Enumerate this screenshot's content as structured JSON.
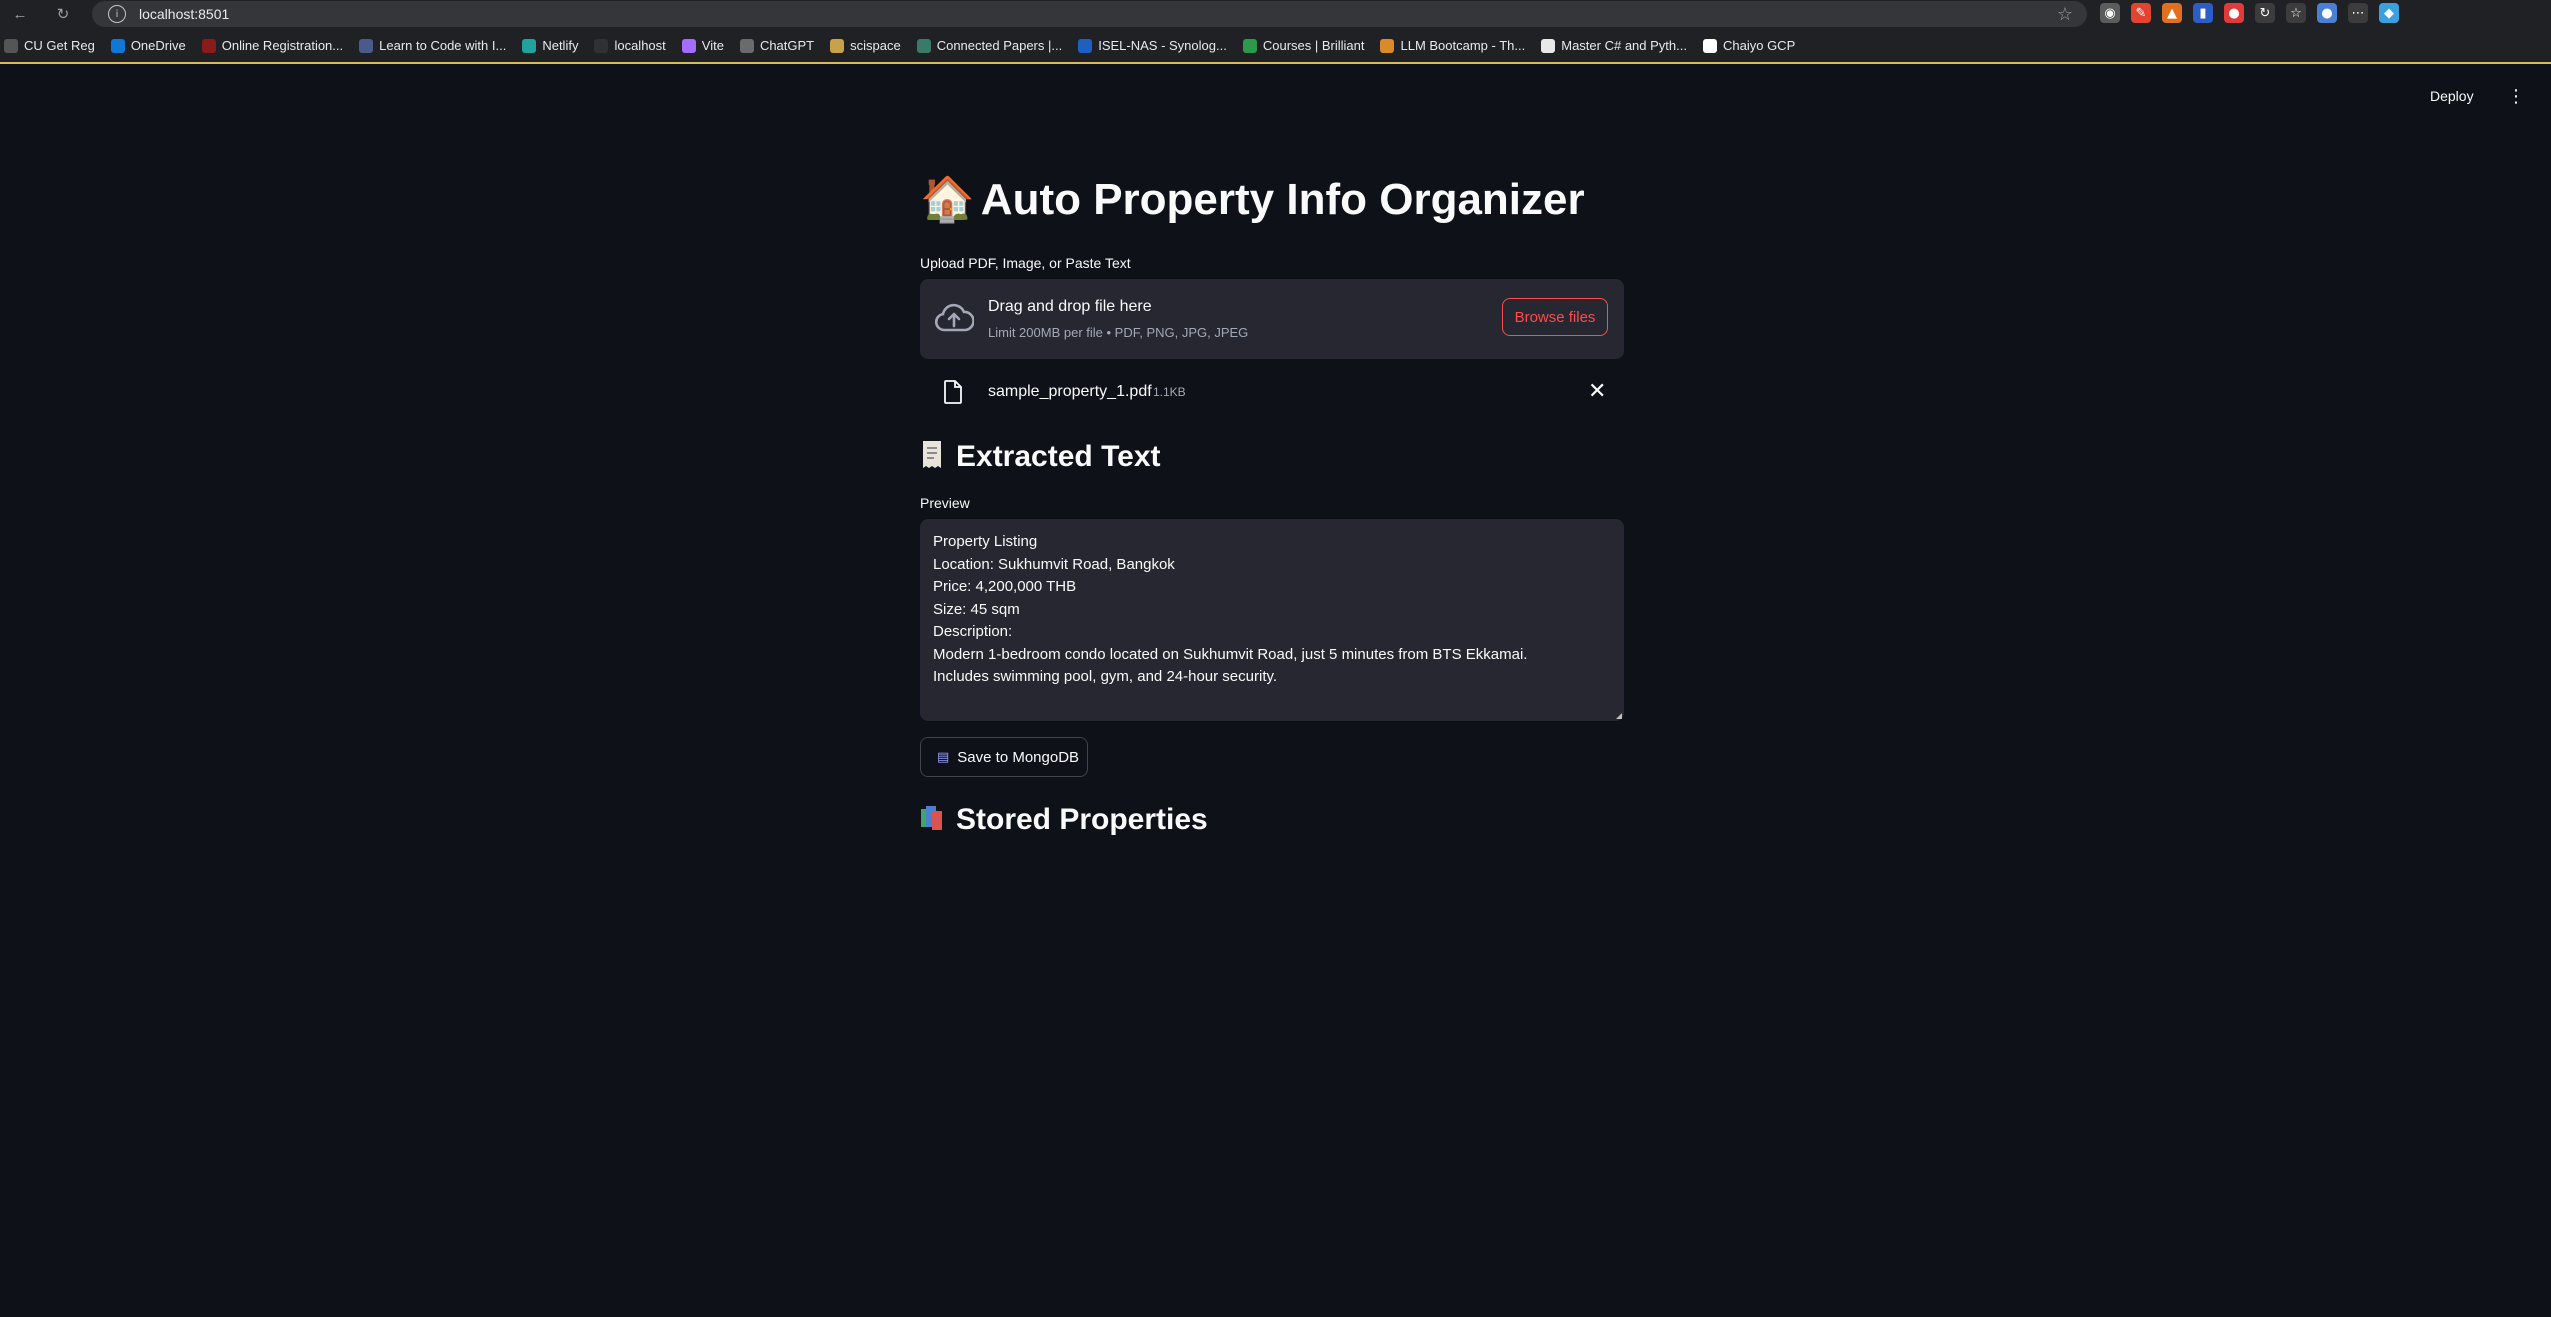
{
  "browser": {
    "url": "localhost:8501",
    "bookmarks": [
      {
        "label": "CU Get Reg",
        "icon": "cu-get-reg-icon",
        "color": "#555555"
      },
      {
        "label": "OneDrive",
        "icon": "onedrive-icon",
        "color": "#0f78d4"
      },
      {
        "label": "Online Registration...",
        "icon": "registration-icon",
        "color": "#8b1a1a"
      },
      {
        "label": "Learn to Code with I...",
        "icon": "learn-code-icon",
        "color": "#4a5a8a"
      },
      {
        "label": "Netlify",
        "icon": "netlify-icon",
        "color": "#20a39e"
      },
      {
        "label": "localhost",
        "icon": "localhost-icon",
        "color": "#303134"
      },
      {
        "label": "Vite",
        "icon": "vite-icon",
        "color": "#a46cff"
      },
      {
        "label": "ChatGPT",
        "icon": "chatgpt-icon",
        "color": "#6b6b6b"
      },
      {
        "label": "scispace",
        "icon": "scispace-icon",
        "color": "#c8a24a"
      },
      {
        "label": "Connected Papers |...",
        "icon": "connected-papers-icon",
        "color": "#3a7a6a"
      },
      {
        "label": "ISEL-NAS - Synolog...",
        "icon": "synology-icon",
        "color": "#1f5fbf"
      },
      {
        "label": "Courses | Brilliant",
        "icon": "brilliant-icon",
        "color": "#2b9a4a"
      },
      {
        "label": "LLM Bootcamp - Th...",
        "icon": "llm-bootcamp-icon",
        "color": "#d98a2a"
      },
      {
        "label": "Master C# and Pyth...",
        "icon": "master-csharp-icon",
        "color": "#e8e8e8"
      },
      {
        "label": "Chaiyo GCP",
        "icon": "google-icon",
        "color": "#ffffff"
      }
    ],
    "extensions": [
      {
        "icon": "mask-extension-icon",
        "color": "#5c5c5c",
        "glyph": "◉"
      },
      {
        "icon": "red-extension-icon",
        "color": "#e2442f",
        "glyph": "✎"
      },
      {
        "icon": "orange-extension-icon",
        "color": "#e07020",
        "glyph": "▲"
      },
      {
        "icon": "flag-extension-icon",
        "color": "#2c5cc5",
        "glyph": "▮"
      },
      {
        "icon": "record-extension-icon",
        "color": "#e03a3a",
        "glyph": "●"
      },
      {
        "icon": "refresh-extension-icon",
        "color": "#3c3c3c",
        "glyph": "↻"
      },
      {
        "icon": "favorites-icon",
        "color": "#3c3c3c",
        "glyph": "☆"
      },
      {
        "icon": "profile-icon",
        "color": "#4a7fd4",
        "glyph": "●"
      },
      {
        "icon": "more-icon",
        "color": "#3c3c3c",
        "glyph": "⋯"
      },
      {
        "icon": "copilot-icon",
        "color": "#3aa0e0",
        "glyph": "◆"
      }
    ]
  },
  "header": {
    "deploy_label": "Deploy",
    "menu_icon": "kebab-menu-icon"
  },
  "main": {
    "title_emoji": "🏠",
    "title": "Auto Property Info Organizer",
    "uploader": {
      "label": "Upload PDF, Image, or Paste Text",
      "drop_text": "Drag and drop file here",
      "limit_text": "Limit 200MB per file • PDF, PNG, JPG, JPEG",
      "browse_label": "Browse files"
    },
    "uploaded_file": {
      "name": "sample_property_1.pdf",
      "size": "1.1KB"
    },
    "extracted": {
      "heading": "Extracted Text",
      "preview_label": "Preview",
      "text": "Property Listing\nLocation: Sukhumvit Road, Bangkok\nPrice: 4,200,000 THB\nSize: 45 sqm\nDescription:\nModern 1-bedroom condo located on Sukhumvit Road, just 5 minutes from BTS Ekkamai.\nIncludes swimming pool, gym, and 24-hour security."
    },
    "save_button_label": "Save to MongoDB",
    "stored": {
      "heading": "Stored Properties"
    }
  },
  "colors": {
    "background": "#0e1117",
    "panel": "#262730",
    "accent": "#ff4b4b",
    "text": "#fafafa"
  }
}
